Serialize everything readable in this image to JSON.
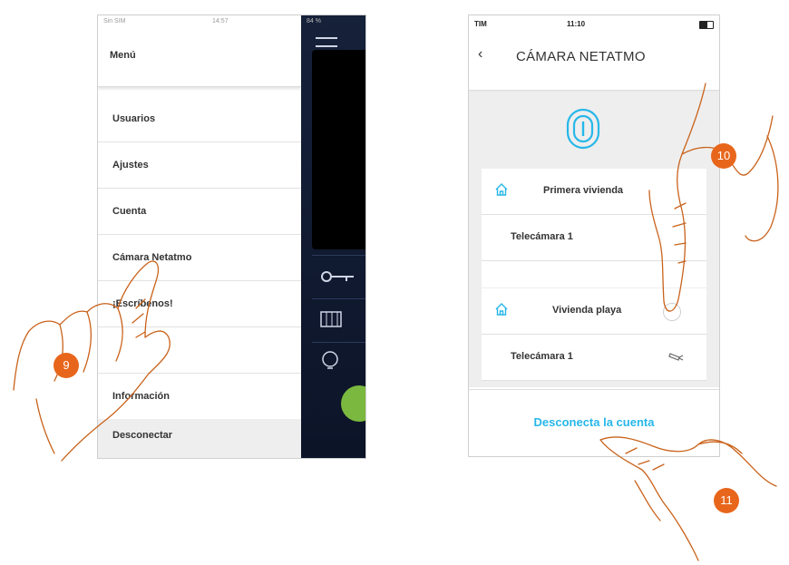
{
  "left_phone": {
    "status": {
      "carrier": "Sin SIM",
      "time": "14:57",
      "battery": "84 %"
    },
    "menu_title": "Menú",
    "menu_items": [
      "Usuarios",
      "Ajustes",
      "Cuenta",
      "Cámara Netatmo",
      "¡Escríbenos!",
      "",
      "Información"
    ],
    "logout_label": "Desconectar"
  },
  "right_phone": {
    "status": {
      "carrier": "TIM",
      "time": "11:10"
    },
    "back_label": "‹",
    "title": "CÁMARA NETATMO",
    "rows": [
      {
        "label": "Primera vivienda",
        "type": "home"
      },
      {
        "label": "Telecámara 1",
        "type": "camera"
      },
      {
        "label": "Vivienda playa",
        "type": "home"
      },
      {
        "label": "Telecámara 1",
        "type": "camera"
      }
    ],
    "disconnect_label": "Desconecta la cuenta"
  },
  "steps": [
    "9",
    "10",
    "11"
  ],
  "colors": {
    "accent": "#27b7e9",
    "badge": "#e8661b",
    "hand_outline": "#c9621a"
  }
}
